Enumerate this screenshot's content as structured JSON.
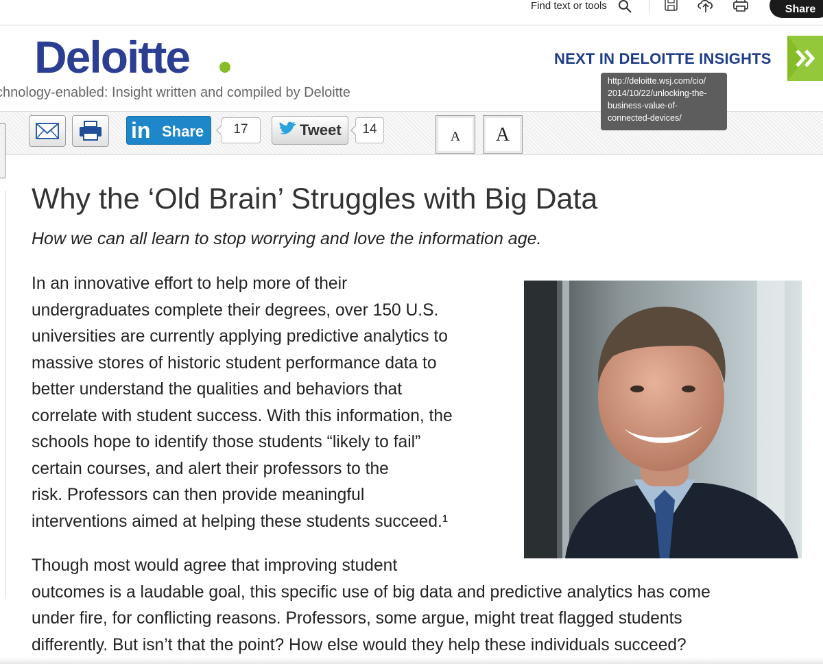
{
  "toolbar": {
    "find_text": "Find text or tools",
    "share_label": "Share",
    "icons": [
      "search-icon",
      "save-icon",
      "cloud-upload-icon",
      "print-icon"
    ]
  },
  "header": {
    "logo_text": "Deloitte",
    "tagline": "chnology-enabled: Insight written and compiled by Deloitte",
    "next_label": "NEXT IN DELOITTE INSIGHTS",
    "tooltip_lines": [
      "http://deloitte.wsj.com/cio/",
      "2014/10/22/unlocking-the-",
      "business-value-of-",
      "connected-devices/"
    ]
  },
  "social": {
    "linkedin_label": "Share",
    "linkedin_icon_text": "in",
    "linkedin_count": "17",
    "tweet_label": "Tweet",
    "tweet_count": "14",
    "font_small": "A",
    "font_large": "A"
  },
  "article": {
    "title": "Why the ‘Old Brain’ Struggles with Big Data",
    "subtitle": "How we can all learn to stop worrying and love the information age.",
    "para1_lines": [
      "In an innovative effort to help more of their",
      "undergraduates complete their degrees, over 150 U.S.",
      "universities are currently applying predictive analytics to",
      "massive stores of historic student performance data to",
      "better understand the qualities and behaviors that",
      "correlate with student success. With this information, the",
      "schools hope to identify those students “likely to fail”",
      "certain courses, and alert their professors to the",
      "risk. Professors can then provide meaningful",
      "interventions aimed at helping these students succeed.¹"
    ],
    "para2_lines": [
      "Though most would agree that improving student",
      "outcomes is a laudable goal, this specific use of big data and predictive analytics has come",
      "under fire, for conflicting reasons. Professors, some argue, might treat flagged students",
      "differently. But isn’t that the point? How else would they help these individuals succeed?"
    ]
  },
  "colors": {
    "brand_blue": "#2c3e91",
    "brand_green": "#86bc25",
    "linkedin_blue": "#1d87c9",
    "next_link": "#1f3d8a"
  }
}
